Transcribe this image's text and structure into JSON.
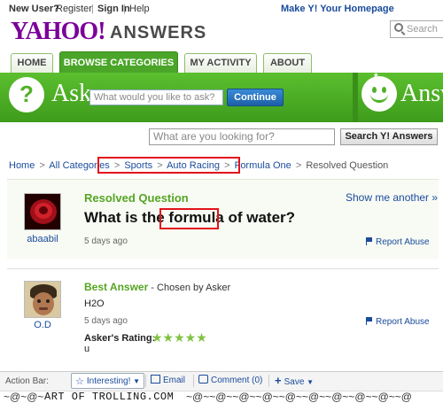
{
  "topbar": {
    "new_user": "New User?",
    "register": "Register",
    "sign_in": "Sign In",
    "help": "Help",
    "homepage": "Make Y! Your Homepage",
    "sep": "|"
  },
  "logo": {
    "yahoo": "YAHOO!",
    "answers": "ANSWERS"
  },
  "top_search": {
    "placeholder": "Search"
  },
  "tabs": [
    {
      "label": "HOME"
    },
    {
      "label": "BROWSE CATEGORIES"
    },
    {
      "label": "MY ACTIVITY"
    },
    {
      "label": "ABOUT"
    }
  ],
  "ask": {
    "label": "Ask",
    "placeholder": "What would you like to ask?",
    "button": "Continue",
    "answer_label": "Answ"
  },
  "main_search": {
    "placeholder": "What are you looking for?",
    "button": "Search Y! Answers"
  },
  "breadcrumb": {
    "home": "Home",
    "all_categories": "All Categories",
    "sports": "Sports",
    "auto_racing": "Auto Racing",
    "formula_one": "Formula One",
    "current": "Resolved Question",
    "sep": ">"
  },
  "question": {
    "status": "Resolved Question",
    "show_me": "Show me another »",
    "title_pre": "What is the ",
    "title_highlight": "formula",
    "title_post": " of water?",
    "asker": "abaabil",
    "time_ago": "5 days ago",
    "report": "Report Abuse"
  },
  "answer": {
    "label": "Best Answer",
    "chosen_by": " - Chosen by Asker",
    "text": "H2O",
    "answerer": "O.D",
    "time_ago": "5 days ago",
    "report": "Report Abuse",
    "rating_label": "Asker's Rating:",
    "stars": "★★★★★",
    "rating_value": 5,
    "rating_comment": "u"
  },
  "action_bar": {
    "label": "Action Bar:",
    "interesting": "Interesting!",
    "email": "Email",
    "comment": "Comment (0)",
    "save": "Save"
  },
  "watermark": {
    "text": "ART OF TROLLING.COM"
  },
  "colors": {
    "brand_purple": "#7b0099",
    "green": "#4aa528",
    "link": "#1a4b9c",
    "highlight_red": "#e2141a"
  }
}
